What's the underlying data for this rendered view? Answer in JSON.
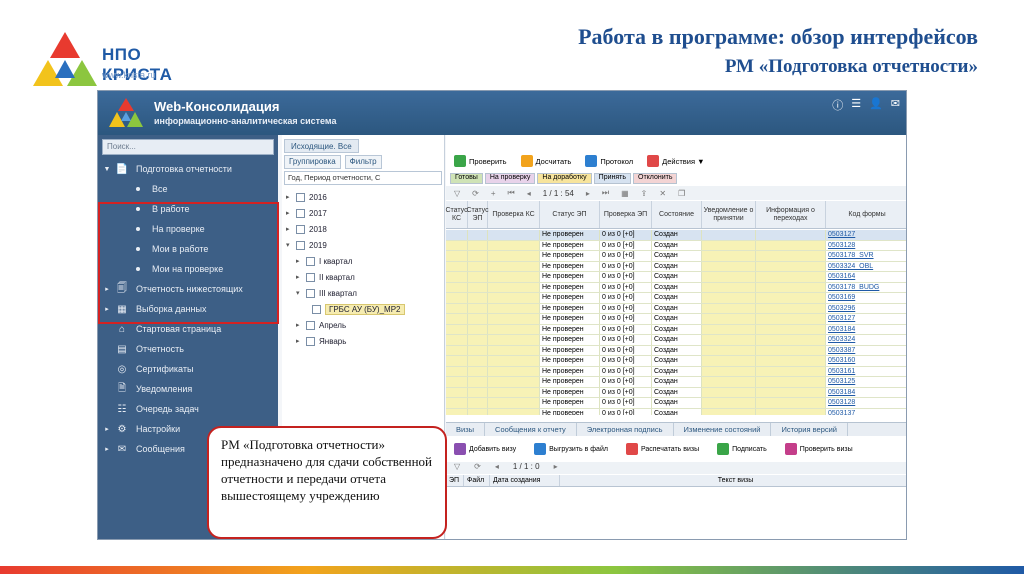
{
  "slide": {
    "title_line1": "Работа в программе: обзор интерфейсов",
    "title_line2": "РМ «Подготовка отчетности»",
    "logo_text": "НПО КРИСТА",
    "logo_url": "www.krista.ru"
  },
  "app": {
    "name": "Web-Консолидация",
    "subtitle": "информационно-аналитическая система",
    "search_placeholder": "Поиск...",
    "nav": [
      {
        "label": "Подготовка отчетности",
        "icon": "document-edit-icon",
        "expanded": true
      },
      {
        "label": "Отчетность нижестоящих",
        "icon": "documents-icon"
      },
      {
        "label": "Выборка данных",
        "icon": "data-select-icon"
      },
      {
        "label": "Стартовая страница",
        "icon": "home-icon"
      },
      {
        "label": "Отчетность",
        "icon": "report-icon"
      },
      {
        "label": "Сертификаты",
        "icon": "certificate-icon"
      },
      {
        "label": "Уведомления",
        "icon": "notification-icon"
      },
      {
        "label": "Очередь задач",
        "icon": "queue-icon"
      },
      {
        "label": "Настройки",
        "icon": "gear-icon"
      },
      {
        "label": "Сообщения",
        "icon": "mail-icon"
      }
    ],
    "nav_sub": [
      "Все",
      "В работе",
      "На проверке",
      "Мои в работе",
      "Мои на проверке"
    ],
    "tree_panel": {
      "tab": "Исходящие. Все",
      "grouping": "Группировка",
      "filter": "Фильтр",
      "filter_value": "Год, Период отчетности, С",
      "nodes": [
        {
          "label": "2016",
          "level": 0
        },
        {
          "label": "2017",
          "level": 0
        },
        {
          "label": "2018",
          "level": 0
        },
        {
          "label": "2019",
          "level": 0
        },
        {
          "label": "I квартал",
          "level": 1
        },
        {
          "label": "II квартал",
          "level": 1
        },
        {
          "label": "III квартал",
          "level": 1
        },
        {
          "label": "ГРБС АУ (БУ)_МР2",
          "level": 2,
          "highlight": true
        },
        {
          "label": "Апрель",
          "level": 1
        },
        {
          "label": "Январь",
          "level": 1
        }
      ]
    },
    "toolbar": [
      {
        "label": "Проверить",
        "color": "#3aa548"
      },
      {
        "label": "Досчитать",
        "color": "#f2a31c"
      },
      {
        "label": "Протокол",
        "color": "#2d7fd0"
      },
      {
        "label": "Действия ▼",
        "color": "#e04848"
      }
    ],
    "status_tabs": [
      {
        "label": "Готовы",
        "color": "#cfe3b6"
      },
      {
        "label": "На проверку",
        "color": "#e8d3ea"
      },
      {
        "label": "На доработку",
        "color": "#f7e49c"
      },
      {
        "label": "Принять",
        "color": "#d6e2f0"
      },
      {
        "label": "Отклонить",
        "color": "#f3d4d4"
      }
    ],
    "pager": "1 / 1 : 54",
    "columns": [
      "Статус КС",
      "Статус ЭП",
      "Проверка КС",
      "Статус ЭП",
      "Проверка ЭП",
      "Состояние",
      "Уведомление о принятии",
      "Информация о переходах",
      "Код формы"
    ],
    "rows": [
      {
        "status": "Не проверен",
        "check": "0 из 0 [+0]",
        "state": "Создан",
        "code": "0503127"
      },
      {
        "status": "Не проверен",
        "check": "0 из 0 [+0]",
        "state": "Создан",
        "code": "0503128"
      },
      {
        "status": "Не проверен",
        "check": "0 из 0 [+0]",
        "state": "Создан",
        "code": "0503178_SVR"
      },
      {
        "status": "Не проверен",
        "check": "0 из 0 [+0]",
        "state": "Создан",
        "code": "0503324_OBL"
      },
      {
        "status": "Не проверен",
        "check": "0 из 0 [+0]",
        "state": "Создан",
        "code": "0503164"
      },
      {
        "status": "Не проверен",
        "check": "0 из 0 [+0]",
        "state": "Создан",
        "code": "0503178_BUDG"
      },
      {
        "status": "Не проверен",
        "check": "0 из 0 [+0]",
        "state": "Создан",
        "code": "0503169"
      },
      {
        "status": "Не проверен",
        "check": "0 из 0 [+0]",
        "state": "Создан",
        "code": "0503296"
      },
      {
        "status": "Не проверен",
        "check": "0 из 0 [+0]",
        "state": "Создан",
        "code": "0503127"
      },
      {
        "status": "Не проверен",
        "check": "0 из 0 [+0]",
        "state": "Создан",
        "code": "0503184"
      },
      {
        "status": "Не проверен",
        "check": "0 из 0 [+0]",
        "state": "Создан",
        "code": "0503324"
      },
      {
        "status": "Не проверен",
        "check": "0 из 0 [+0]",
        "state": "Создан",
        "code": "0503387"
      },
      {
        "status": "Не проверен",
        "check": "0 из 0 [+0]",
        "state": "Создан",
        "code": "0503160"
      },
      {
        "status": "Не проверен",
        "check": "0 из 0 [+0]",
        "state": "Создан",
        "code": "0503161"
      },
      {
        "status": "Не проверен",
        "check": "0 из 0 [+0]",
        "state": "Создан",
        "code": "0503125"
      },
      {
        "status": "Не проверен",
        "check": "0 из 0 [+0]",
        "state": "Создан",
        "code": "0503184"
      },
      {
        "status": "Не проверен",
        "check": "0 из 0 [+0]",
        "state": "Создан",
        "code": "0503128"
      },
      {
        "status": "Не проверен",
        "check": "0 из 0 [+0]",
        "state": "Создан",
        "code": "0503137"
      }
    ],
    "bottom_tabs": [
      "Визы",
      "Сообщения к отчету",
      "Электронная подпись",
      "Изменение состояний",
      "История версий"
    ],
    "bottom_toolbar": [
      "Добавить визу",
      "Выгрузить в файл",
      "Распечатать визы",
      "Подписать",
      "Проверить визы"
    ],
    "bottom_pager": "1 / 1 : 0",
    "bottom_columns": [
      "ЭП",
      "Файл",
      "Дата создания",
      "Текст визы"
    ]
  },
  "callout": "РМ «Подготовка отчетности» предназначено для сдачи собственной отчетности и передачи отчета вышестоящему учреждению"
}
